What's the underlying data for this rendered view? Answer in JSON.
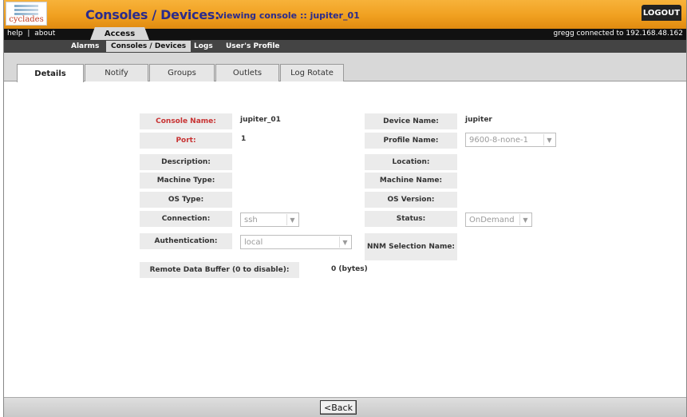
{
  "header": {
    "logo_text": "cyclades",
    "title": "Consoles / Devices:",
    "subtitle": "viewing console :: jupiter_01",
    "logout_label": "LOGOUT"
  },
  "topnav": {
    "help": "help",
    "separator": "|",
    "about": "about",
    "access_tab": "Access",
    "connection": "gregg connected to 192.168.48.162"
  },
  "subnav": {
    "alarms": "Alarms",
    "consoles": "Consoles / Devices",
    "logs": "Logs",
    "profile": "User's Profile"
  },
  "tabs": [
    "Details",
    "Notify",
    "Groups",
    "Outlets",
    "Log Rotate"
  ],
  "form": {
    "console_name_label": "Console Name:",
    "console_name_value": "jupiter_01",
    "device_name_label": "Device Name:",
    "device_name_value": "jupiter",
    "port_label": "Port:",
    "port_value": "1",
    "profile_name_label": "Profile Name:",
    "profile_name_value": "9600-8-none-1",
    "description_label": "Description:",
    "location_label": "Location:",
    "machine_type_label": "Machine Type:",
    "machine_name_label": "Machine Name:",
    "os_type_label": "OS Type:",
    "os_version_label": "OS Version:",
    "connection_label": "Connection:",
    "connection_value": "ssh",
    "status_label": "Status:",
    "status_value": "OnDemand",
    "authentication_label": "Authentication:",
    "authentication_value": "local",
    "nnm_label": "NNM Selection Name:",
    "rdb_label": "Remote Data Buffer (0 to disable):",
    "rdb_value": "0 (bytes)"
  },
  "footer": {
    "back_label": "<Back"
  }
}
